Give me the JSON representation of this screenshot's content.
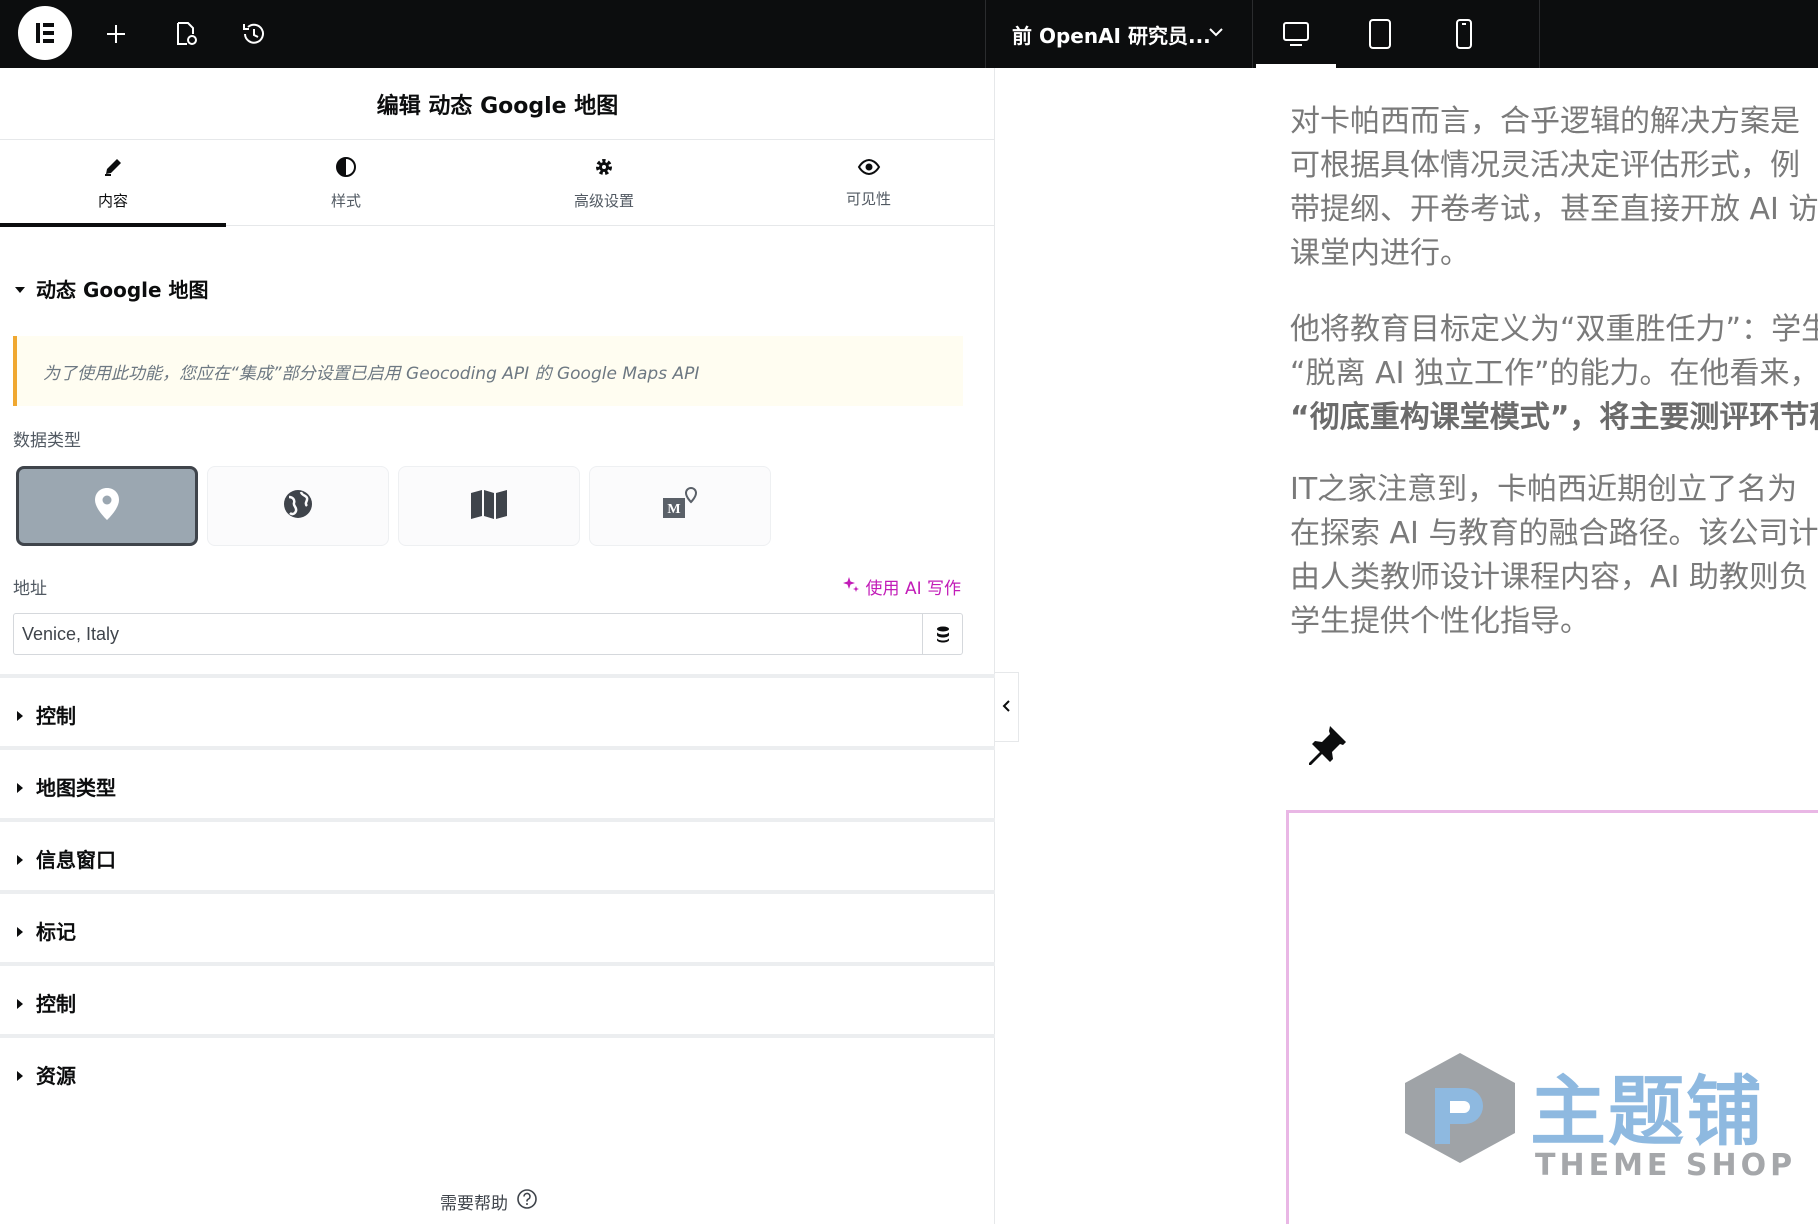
{
  "topbar": {
    "document_title": "前 OpenAI 研究员...",
    "devices": [
      "desktop",
      "tablet",
      "mobile"
    ]
  },
  "panel": {
    "title": "编辑 动态 Google 地图",
    "tabs": [
      {
        "label": "内容",
        "icon": "pencil-icon"
      },
      {
        "label": "样式",
        "icon": "half-circle-icon"
      },
      {
        "label": "高级设置",
        "icon": "gear-icon"
      },
      {
        "label": "可见性",
        "icon": "eye-icon"
      }
    ],
    "section_title": "动态 Google 地图",
    "notice": "为了使用此功能，您应在“集成”部分设置已启用 Geocoding API 的 Google Maps API",
    "data_type_label": "数据类型",
    "data_types": [
      "location-pin-icon",
      "globe-icon",
      "map-icon",
      "marker-icon"
    ],
    "address_label": "地址",
    "ai_write": "使用 AI 写作",
    "address_value": "Venice, Italy",
    "sections": [
      "控制",
      "地图类型",
      "信息窗口",
      "标记",
      "控制",
      "资源"
    ],
    "help": "需要帮助"
  },
  "preview": {
    "para1": [
      "对卡帕西而言，合乎逻辑的解决方案是",
      "可根据具体情况灵活决定评估形式，例",
      "带提纲、开卷考试，甚至直接开放 AI 访",
      "课堂内进行。"
    ],
    "para2": [
      "他将教育目标定义为“双重胜任力”：学生",
      "“脱离 AI 独立工作”的能力。在他看来，"
    ],
    "para2_bold": "“彻底重构课堂模式”，将主要测评环节移",
    "para3": [
      "IT之家注意到，卡帕西近期创立了名为",
      "在探索 AI 与教育的融合路径。该公司计",
      "由人类教师设计课程内容，AI 助教则负",
      "学生提供个性化指导。"
    ],
    "watermark_main": "主题铺",
    "watermark_sub": "THEME SHOP"
  },
  "colors": {
    "topbar_bg": "#0c0d0e",
    "ai_accent": "#c21cb8",
    "notice_border": "#f0a830",
    "active_type_bg": "#9ba7b1",
    "map_border": "#e9b7e5"
  }
}
